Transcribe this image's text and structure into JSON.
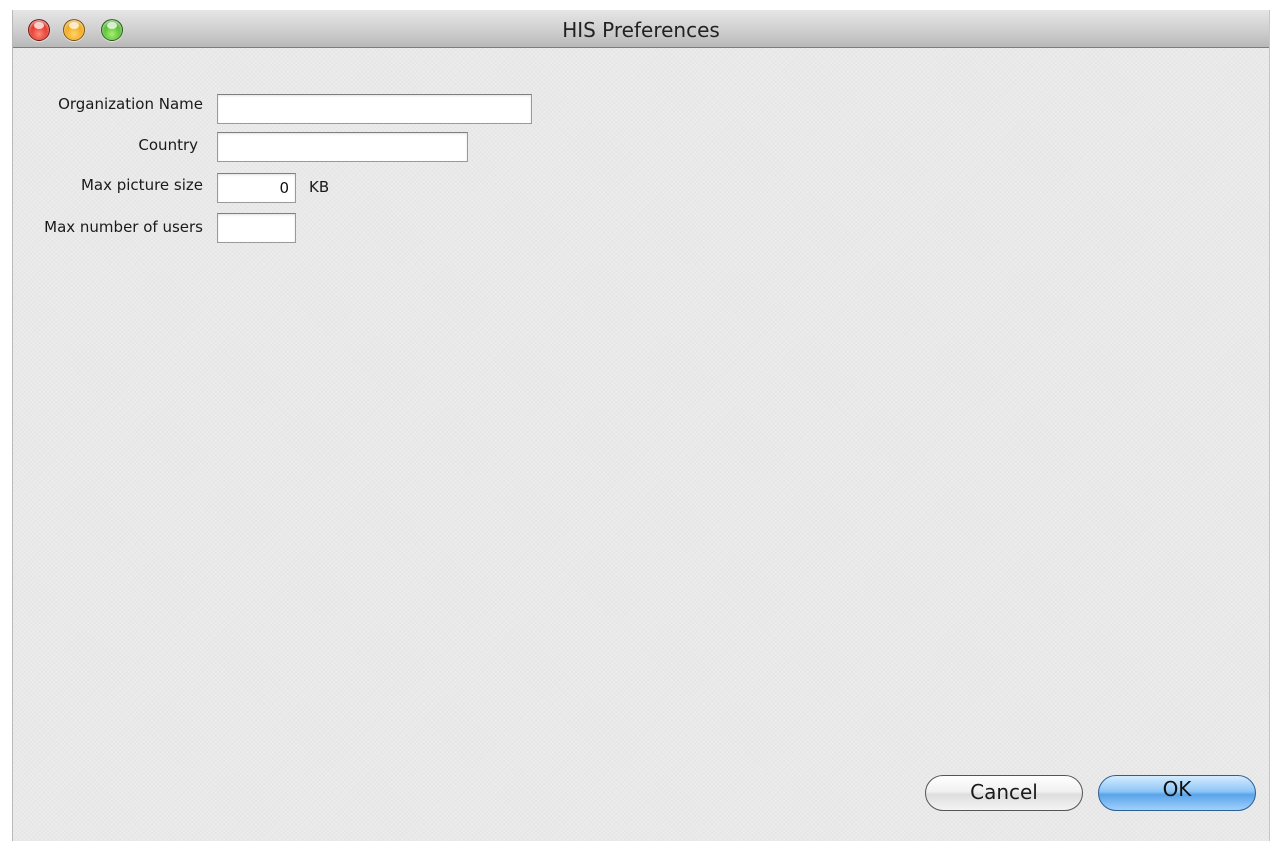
{
  "window": {
    "title": "HIS Preferences"
  },
  "title_bar_buttons": {
    "close": "close-icon",
    "minimize": "minimize-icon",
    "zoom": "zoom-icon"
  },
  "form": {
    "organization_name": {
      "label": "Organization Name",
      "value": ""
    },
    "country": {
      "label": "Country",
      "value": ""
    },
    "max_picture_size": {
      "label": "Max picture size",
      "value": "0",
      "unit": "KB"
    },
    "max_users": {
      "label": "Max number of users",
      "value": ""
    }
  },
  "buttons": {
    "cancel": "Cancel",
    "ok": "OK"
  },
  "colors": {
    "window_bg": "#e9e9e9",
    "close": "#e0281c",
    "minimize": "#eea20c",
    "zoom": "#4bb52a",
    "default_button": "#5aa4ea"
  }
}
